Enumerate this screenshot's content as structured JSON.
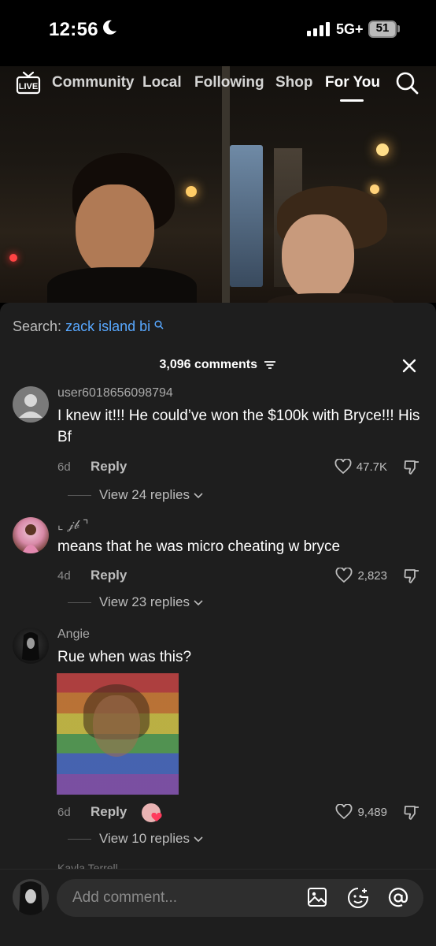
{
  "status_bar": {
    "time": "12:56",
    "network": "5G+",
    "battery": "51"
  },
  "top_nav": {
    "tabs": [
      "Community",
      "Local",
      "Following",
      "Shop",
      "For You"
    ],
    "active_tab": "For You",
    "live_label": "LIVE"
  },
  "comments_sheet": {
    "search_prefix": "Search:",
    "search_query": "zack island bi",
    "comment_count": "3,096 comments",
    "comments": [
      {
        "username": "user6018656098794",
        "text": "I knew it!!! He could’ve won the $100k with Bryce!!! His Bf",
        "age": "6d",
        "reply_label": "Reply",
        "likes": "47.7K",
        "view_replies": "View 24 replies"
      },
      {
        "username": "⌞ 𝒿𝒷 ⌝",
        "text": "means that he was micro cheating w bryce",
        "age": "4d",
        "reply_label": "Reply",
        "likes": "2,823",
        "view_replies": "View 23 replies"
      },
      {
        "username": "Angie",
        "text": "Rue when was this?",
        "age": "6d",
        "reply_label": "Reply",
        "likes": "9,489",
        "view_replies": "View 10 replies"
      }
    ],
    "partial_next_username": "Kayla Terrell"
  },
  "input_bar": {
    "placeholder": "Add comment..."
  },
  "colors": {
    "sheet_bg": "#1e1e1e",
    "link_blue": "#58a8ff",
    "muted_text": "#8a8a8a"
  }
}
